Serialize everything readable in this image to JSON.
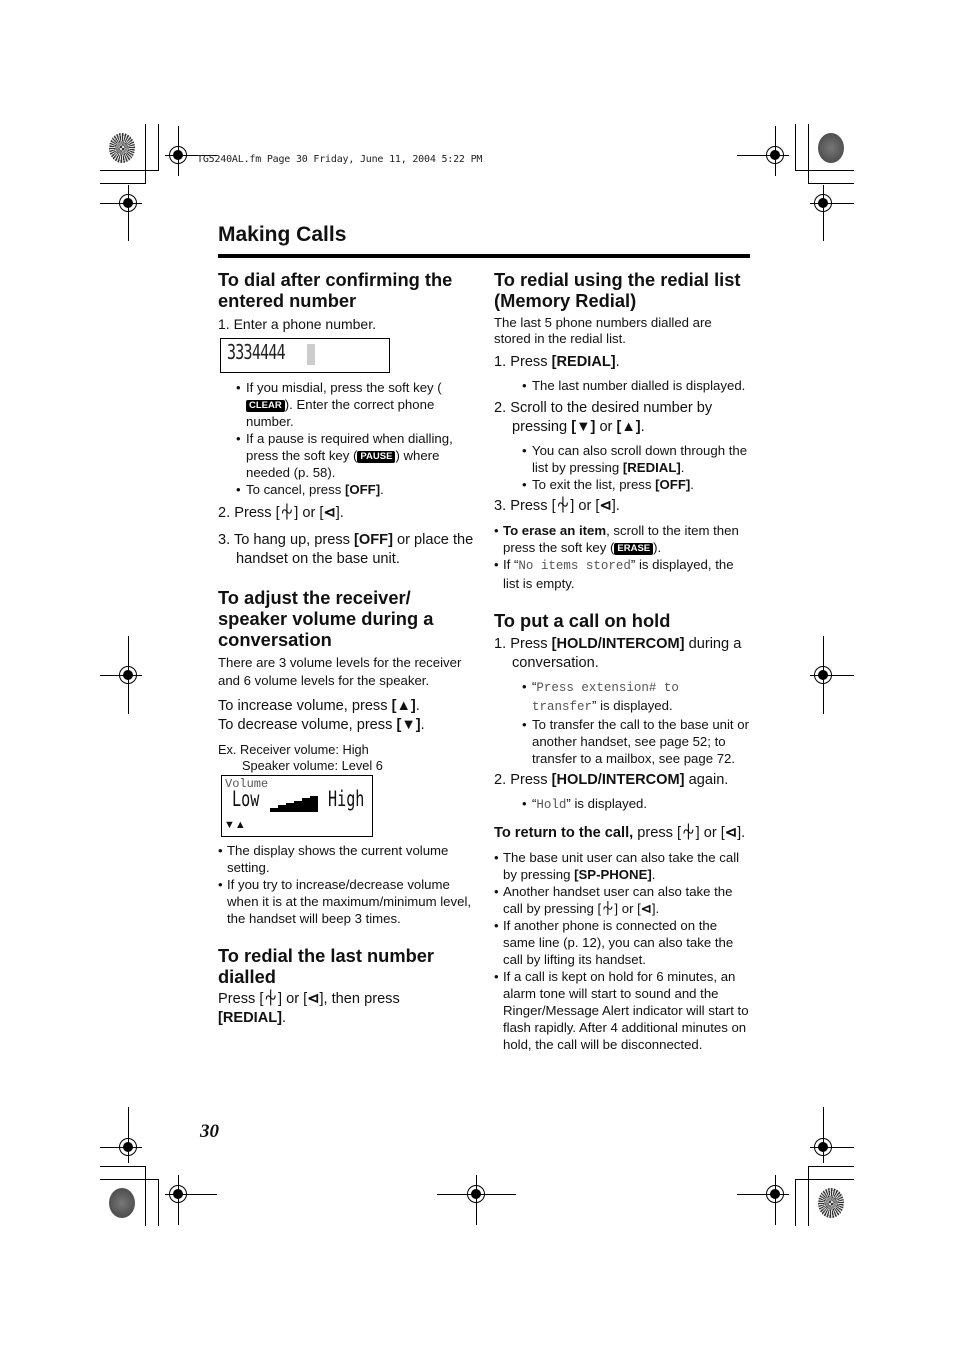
{
  "print_stamp": "TG5240AL.fm  Page 30  Friday, June 11, 2004  5:22 PM",
  "section_title": "Making Calls",
  "page_number": "30",
  "icons": {
    "talk": "⏆",
    "speaker": "⊲",
    "down": "▼",
    "up": "▲"
  },
  "left": {
    "dial_confirm": {
      "heading": "To dial after confirming the entered number",
      "step1": "1. Enter a phone number.",
      "lcd_number": "3334444",
      "bullets": [
        {
          "pre": "If you misdial, press the soft key (",
          "key": "CLEAR",
          "post": "). Enter the correct phone number."
        },
        {
          "pre": "If a pause is required when dialling, press the soft key (",
          "key": "PAUSE",
          "post": ") where needed (p. 58)."
        },
        {
          "pre": "To cancel, press ",
          "bold": "[OFF]",
          "post": "."
        }
      ],
      "step2_pre": "2. Press [",
      "step2_mid": "] or [",
      "step2_post": "].",
      "step3_pre": "3. To hang up, press ",
      "step3_bold": "[OFF]",
      "step3_post": " or place the handset on the base unit."
    },
    "volume": {
      "heading": "To adjust the receiver/ speaker volume during a conversation",
      "intro": "There are 3 volume levels for the receiver and 6 volume levels for the speaker.",
      "increase_pre": "To increase volume, press ",
      "increase_key": "[▲]",
      "decrease_pre": "To decrease volume, press ",
      "decrease_key": "[▼]",
      "example_line1": "Ex. Receiver volume: High",
      "example_line2": "Speaker volume: Level 6",
      "lcd_label": "Volume",
      "lcd_low": "Low",
      "lcd_high": "High",
      "lcd_arrows": "▼▲",
      "speaker_level": 6,
      "speaker_max": 6,
      "bullets": [
        "The display shows the current volume setting.",
        "If you try to increase/decrease volume when it is at the maximum/minimum level, the handset will beep 3 times."
      ]
    },
    "redial_last": {
      "heading": "To redial the last number dialled",
      "text_pre": "Press [",
      "text_mid": "] or [",
      "text_post": "], then press",
      "bold": "[REDIAL]",
      "end": "."
    }
  },
  "right": {
    "memory_redial": {
      "heading": "To redial using the redial list (Memory Redial)",
      "intro": "The last 5 phone numbers dialled are stored in the redial list.",
      "step1_pre": "1. Press ",
      "step1_bold": "[REDIAL]",
      "step1_bullet": "The last number dialled is displayed.",
      "step2_pre": "2. Scroll to the desired number by pressing ",
      "step2_b1": "[▼]",
      "step2_mid": " or ",
      "step2_b2": "[▲]",
      "step2_bullets": [
        {
          "pre": "You can also scroll down through the list by pressing ",
          "bold": "[REDIAL]",
          "post": "."
        },
        {
          "pre": "To exit the list, press ",
          "bold": "[OFF]",
          "post": "."
        }
      ],
      "step3_pre": "3. Press [",
      "step3_mid": "] or [",
      "step3_post": "].",
      "erase_bold": "To erase an item",
      "erase_text": ", scroll to the item then press the soft key (",
      "erase_key": "ERASE",
      "erase_end": ").",
      "empty_pre": "If “",
      "empty_mono": "No items stored",
      "empty_post": "” is displayed, the list is empty."
    },
    "hold": {
      "heading": "To put a call on hold",
      "step1_pre": "1. Press ",
      "step1_bold": "[HOLD/INTERCOM]",
      "step1_post": " during a conversation.",
      "step1_bullet1_mono": "Press extension# to transfer",
      "step1_bullet1_post": "” is displayed.",
      "step1_bullet2": "To transfer the call to the base unit or another handset, see page 52; to transfer to a mailbox, see page 72.",
      "step2_pre": "2. Press ",
      "step2_bold": "[HOLD/INTERCOM]",
      "step2_post": " again.",
      "step2_bullet_mono": "Hold",
      "step2_bullet_post": "” is displayed.",
      "return_bold": "To return to the call,",
      "return_pre": " press [",
      "return_mid": "] or [",
      "return_post": "].",
      "bullets": [
        {
          "pre": "The base unit user can also take the call by pressing ",
          "bold": "[SP-PHONE]",
          "post": "."
        },
        {
          "pre": "Another handset user can also take the call by pressing [",
          "icon1": true,
          "mid": "] or [",
          "post": "]."
        },
        {
          "pre": "If another phone is connected on the same line (p. 12), you can also take the call by lifting its handset."
        },
        {
          "pre": "If a call is kept on hold for 6 minutes, an alarm tone will start to sound and the Ringer/Message Alert indicator will start to flash rapidly. After 4 additional minutes on hold, the call will be disconnected."
        }
      ]
    }
  }
}
